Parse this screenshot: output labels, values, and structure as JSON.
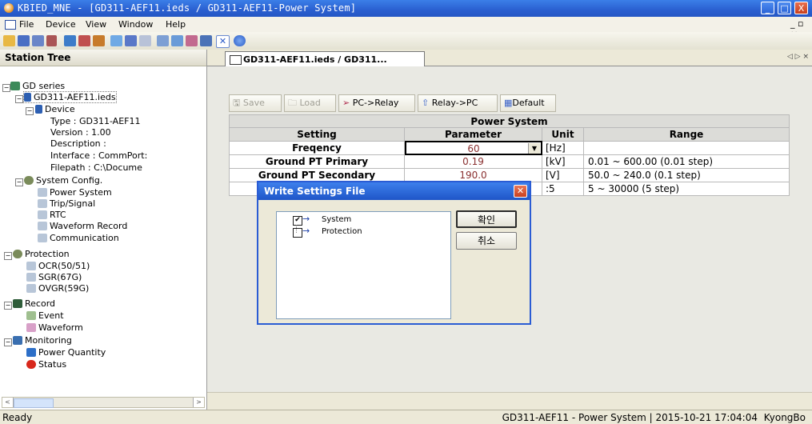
{
  "window": {
    "title": "KBIED_MNE - [GD311-AEF11.ieds / GD311-AEF11-Power System]",
    "controls": {
      "minimize": "_",
      "maximize": "□",
      "close": "X"
    },
    "mdi_controls": "_ ▫ ×"
  },
  "menu": {
    "items": [
      "File",
      "Device",
      "View",
      "Window",
      "Help"
    ]
  },
  "station_tree": {
    "header": "Station Tree",
    "root": "GD series",
    "ieds": "GD311-AEF11.ieds",
    "device": "Device",
    "device_props": [
      "Type : GD311-AEF11",
      "Version : 1.00",
      "Description :",
      "Interface : CommPort:",
      "Filepath : C:\\Docume"
    ],
    "system_config": "System Config.",
    "system_items": [
      "Power System",
      "Trip/Signal",
      "RTC",
      "Waveform Record",
      "Communication"
    ],
    "protection": "Protection",
    "protection_items": [
      "OCR(50/51)",
      "SGR(67G)",
      "OVGR(59G)"
    ],
    "record": "Record",
    "record_items": [
      "Event",
      "Waveform"
    ],
    "monitoring": "Monitoring",
    "monitoring_items": [
      "Power Quantity",
      "Status"
    ]
  },
  "tab": {
    "label": "GD311-AEF11.ieds / GD311...",
    "nav": "◁ ▷ ×"
  },
  "actions": {
    "save": "Save",
    "load": "Load",
    "pc_relay": "PC->Relay",
    "relay_pc": "Relay->PC",
    "default": "Default"
  },
  "table": {
    "caption": "Power System",
    "headers": [
      "Setting",
      "Parameter",
      "Unit",
      "Range"
    ],
    "rows": [
      {
        "setting": "Freqency",
        "parameter": "60",
        "unit": "[Hz]",
        "range": ""
      },
      {
        "setting": "Ground PT Primary",
        "parameter": "0.19",
        "unit": "[kV]",
        "range": "0.01 ~ 600.00 (0.01 step)"
      },
      {
        "setting": "Ground PT Secondary",
        "parameter": "190.0",
        "unit": "[V]",
        "range": "50.0 ~ 240.0 (0.1 step)"
      },
      {
        "setting": "",
        "parameter": "",
        "unit": ":5",
        "range": "5 ~ 30000 (5 step)"
      }
    ]
  },
  "dialog": {
    "title": "Write Settings File",
    "items": [
      {
        "label": "System",
        "checked": true
      },
      {
        "label": "Protection",
        "checked": false
      }
    ],
    "ok": "확인",
    "cancel": "취소"
  },
  "status": {
    "ready": "Ready",
    "info": "GD311-AEF11 - Power System | 2015-10-21 17:04:04",
    "user": "KyongBo"
  }
}
